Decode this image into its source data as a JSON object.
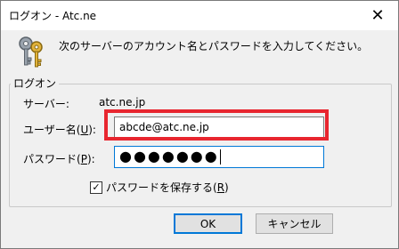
{
  "window": {
    "title": "ログオン - Atc.ne",
    "close_glyph": "✕"
  },
  "icon": {
    "name": "keys-icon"
  },
  "prompt": "次のサーバーのアカウント名とパスワードを入力してください。",
  "group": {
    "legend": "ログオン",
    "server_label": "サーバー:",
    "server_value": "atc.ne.jp",
    "username_label_pre": "ユーザー名(",
    "username_label_key": "U",
    "username_label_post": "):",
    "username_value": "abcde@atc.ne.jp",
    "password_label_pre": "パスワード(",
    "password_label_key": "P",
    "password_label_post": "):",
    "password_mask": "●●●●●●●"
  },
  "save_password": {
    "checked": true,
    "check_glyph": "✓",
    "label_pre": "パスワードを保存する(",
    "label_key": "R",
    "label_post": ")"
  },
  "buttons": {
    "ok": "OK",
    "cancel": "キャンセル"
  },
  "colors": {
    "highlight": "#e8262f",
    "focus": "#0078d7"
  }
}
